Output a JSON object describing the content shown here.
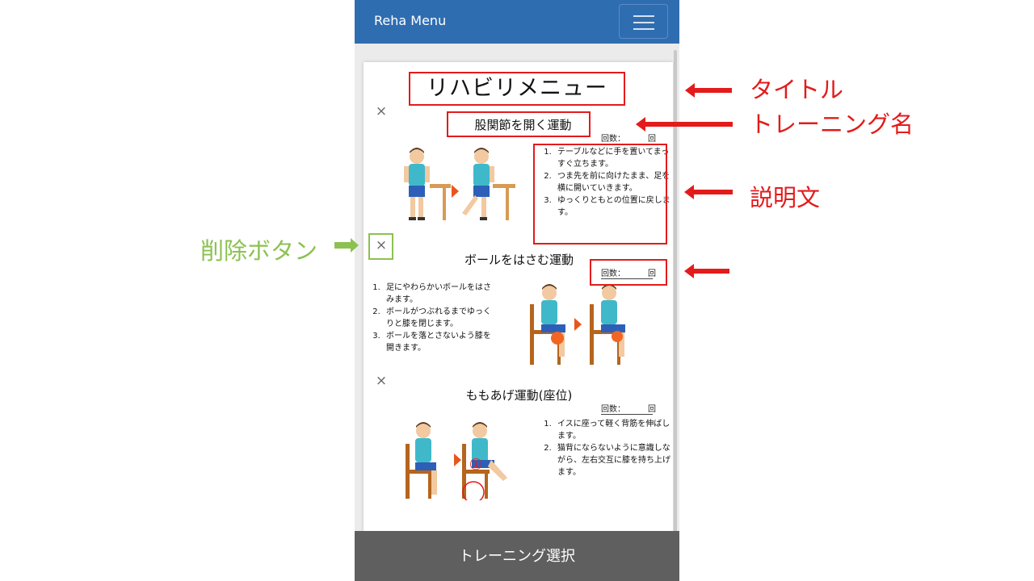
{
  "navbar": {
    "brand": "Reha Menu",
    "menu_icon": "hamburger-icon"
  },
  "page": {
    "title": "リハビリメニュー",
    "delete_symbol": "×"
  },
  "exercises": [
    {
      "name": "股関節を開く運動",
      "count_label": "回数：",
      "count_unit": "回",
      "steps": [
        "テーブルなどに手を置いてまっすぐ立ちます。",
        "つま先を前に向けたまま、足を横に開いていきます。",
        "ゆっくりともとの位置に戻します。"
      ]
    },
    {
      "name": "ボールをはさむ運動",
      "count_label": "回数：",
      "count_unit": "回",
      "steps": [
        "足にやわらかいボールをはさみます。",
        "ボールがつぶれるまでゆっくりと膝を閉じます。",
        "ボールを落とさないよう膝を開きます。"
      ]
    },
    {
      "name": "ももあげ運動(座位)",
      "count_label": "回数：",
      "count_unit": "回",
      "steps": [
        "イスに座って軽く背筋を伸ばします。",
        "猫背にならないように意識しながら、左右交互に膝を持ち上げます。"
      ]
    }
  ],
  "footer": {
    "button_label": "トレーニング選択"
  },
  "annotations": {
    "title_label": "タイトル",
    "training_name_label": "トレーニング名",
    "description_label": "説明文",
    "delete_button_label": "削除ボタン",
    "step_marker": "①"
  },
  "colors": {
    "navbar": "#2f6db1",
    "footer": "#5f5f5f",
    "annotation_red": "#e31b1b",
    "annotation_green": "#8cc152",
    "step_arrow": "#e8561e"
  }
}
